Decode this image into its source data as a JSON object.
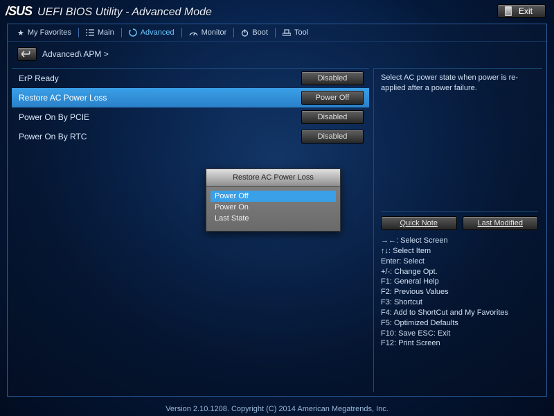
{
  "header": {
    "brand": "/SUS",
    "title": "UEFI BIOS Utility - Advanced Mode",
    "exit_label": "Exit"
  },
  "tabs": [
    {
      "label": "My Favorites",
      "icon": "star"
    },
    {
      "label": "Main",
      "icon": "list"
    },
    {
      "label": "Advanced",
      "icon": "refresh",
      "active": true
    },
    {
      "label": "Monitor",
      "icon": "gauge"
    },
    {
      "label": "Boot",
      "icon": "power"
    },
    {
      "label": "Tool",
      "icon": "tool"
    }
  ],
  "breadcrumb": "Advanced\\ APM >",
  "settings": [
    {
      "label": "ErP Ready",
      "value": "Disabled",
      "selected": false
    },
    {
      "label": "Restore AC Power Loss",
      "value": "Power Off",
      "selected": true
    },
    {
      "label": "Power On By PCIE",
      "value": "Disabled",
      "selected": false
    },
    {
      "label": "Power On By RTC",
      "value": "Disabled",
      "selected": false
    }
  ],
  "popup": {
    "title": "Restore AC Power Loss",
    "items": [
      "Power Off",
      "Power On",
      "Last State"
    ],
    "selected_index": 0
  },
  "help": {
    "text": "Select AC power state when power is re-applied after a power failure.",
    "quick_note": "Quick Note",
    "last_modified": "Last Modified"
  },
  "hints": [
    "→←: Select Screen",
    "↑↓: Select Item",
    "Enter: Select",
    "+/-: Change Opt.",
    "F1: General Help",
    "F2: Previous Values",
    "F3: Shortcut",
    "F4: Add to ShortCut and My Favorites",
    "F5: Optimized Defaults",
    "F10: Save  ESC: Exit",
    "F12: Print Screen"
  ],
  "footer": "Version 2.10.1208. Copyright (C) 2014 American Megatrends, Inc."
}
